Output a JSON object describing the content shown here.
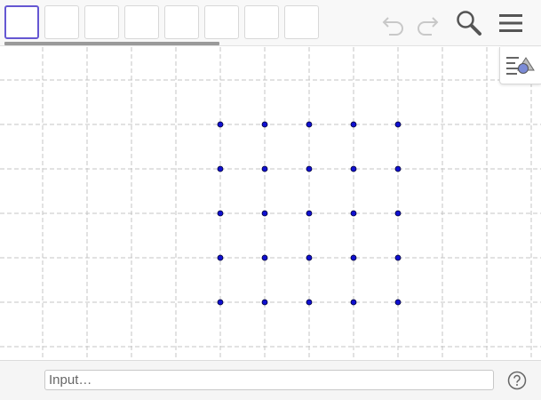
{
  "toolbar": {
    "tools": [
      {
        "icon": "tool-1-icon",
        "selected": true
      },
      {
        "icon": "tool-2-icon",
        "selected": false
      },
      {
        "icon": "tool-3-icon",
        "selected": false
      },
      {
        "icon": "tool-4-icon",
        "selected": false
      },
      {
        "icon": "tool-5-icon",
        "selected": false
      },
      {
        "icon": "tool-6-icon",
        "selected": false
      },
      {
        "icon": "tool-7-icon",
        "selected": false
      },
      {
        "icon": "tool-8-icon",
        "selected": false
      }
    ],
    "undo_icon": "undo-icon",
    "redo_icon": "redo-icon",
    "search_icon": "search-icon",
    "menu_icon": "hamburger-menu-icon"
  },
  "graphics": {
    "grid": "dashed",
    "point_color": "#1010d0",
    "points": [
      {
        "x": 0,
        "y": 0
      },
      {
        "x": 1,
        "y": 0
      },
      {
        "x": 2,
        "y": 0
      },
      {
        "x": 3,
        "y": 0
      },
      {
        "x": 4,
        "y": 0
      },
      {
        "x": 0,
        "y": 1
      },
      {
        "x": 1,
        "y": 1
      },
      {
        "x": 2,
        "y": 1
      },
      {
        "x": 3,
        "y": 1
      },
      {
        "x": 4,
        "y": 1
      },
      {
        "x": 0,
        "y": 2
      },
      {
        "x": 1,
        "y": 2
      },
      {
        "x": 2,
        "y": 2
      },
      {
        "x": 3,
        "y": 2
      },
      {
        "x": 4,
        "y": 2
      },
      {
        "x": 0,
        "y": 3
      },
      {
        "x": 1,
        "y": 3
      },
      {
        "x": 2,
        "y": 3
      },
      {
        "x": 3,
        "y": 3
      },
      {
        "x": 4,
        "y": 3
      },
      {
        "x": 0,
        "y": 4
      },
      {
        "x": 1,
        "y": 4
      },
      {
        "x": 2,
        "y": 4
      },
      {
        "x": 3,
        "y": 4
      },
      {
        "x": 4,
        "y": 4
      }
    ],
    "style_bar_icon": "style-bar-toggle-icon"
  },
  "input_bar": {
    "placeholder": "Input…",
    "value": "",
    "help_icon": "help-icon"
  },
  "colors": {
    "accent": "#6557d2",
    "point": "#1010d0",
    "grid": "#c4c4c4"
  }
}
